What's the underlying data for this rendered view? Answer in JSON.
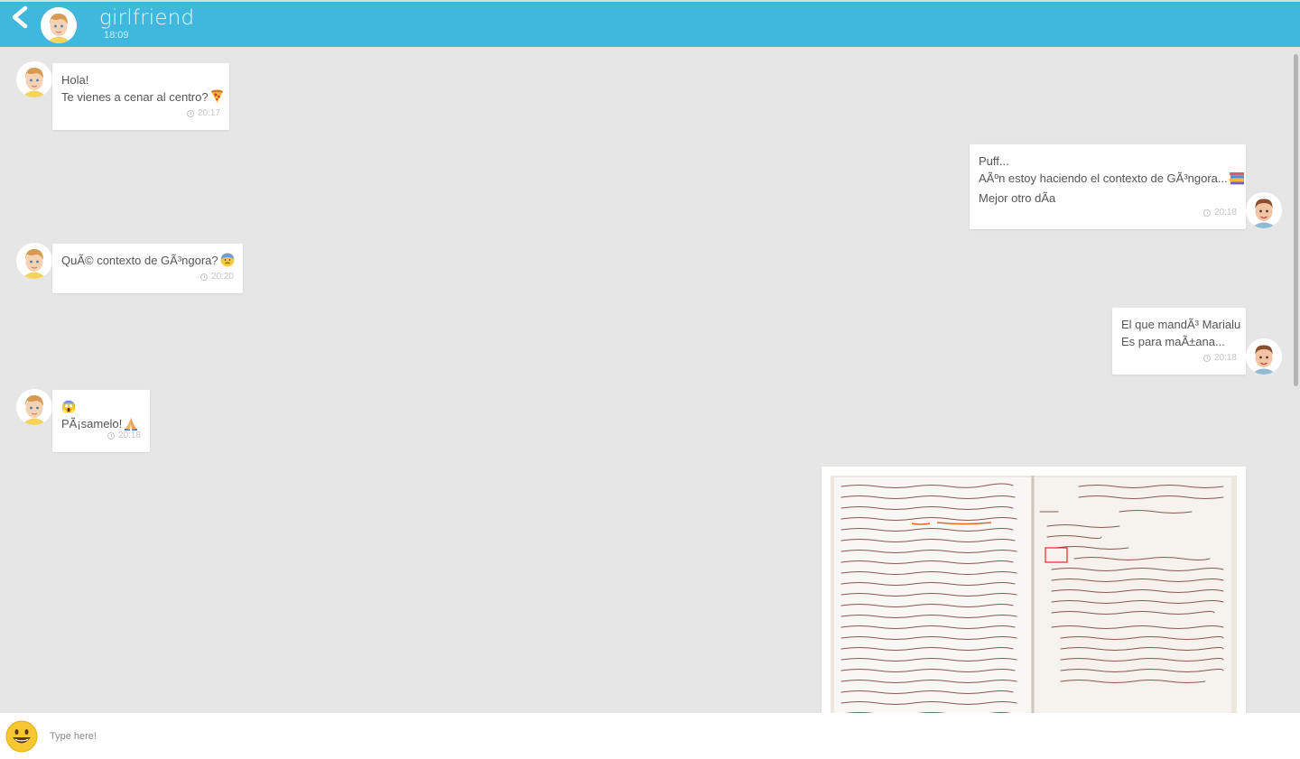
{
  "header": {
    "contact_name": "girlfriend",
    "last_seen": "18:09",
    "color": "#40b8de"
  },
  "messages": [
    {
      "side": "received",
      "lines": [
        "Hola!",
        "Te vienes a cenar al centro?"
      ],
      "emoji": "pizza",
      "time": "20:17"
    },
    {
      "side": "sent",
      "lines": [
        "Puff...",
        "AÃºn estoy haciendo el contexto de GÃ³ngora...",
        "Mejor otro dÃa"
      ],
      "emoji": "books",
      "time": "20:18"
    },
    {
      "side": "received",
      "lines": [
        "QuÃ© contexto de GÃ³ngora?"
      ],
      "emoji": "anxious-face",
      "time": "20:20"
    },
    {
      "side": "sent",
      "lines": [
        "El que mandÃ³ Marialu",
        "Es para maÃ±ana..."
      ],
      "time": "20:18"
    },
    {
      "side": "received",
      "lines": [
        "😱",
        "PÃ¡samelo!"
      ],
      "emoji": "folded-hands",
      "time": "20:18"
    },
    {
      "side": "sent",
      "type": "image",
      "image": "handwritten-notes-photo"
    }
  ],
  "composer": {
    "placeholder": "Type here!",
    "emoji_icon": "smiley-icon"
  }
}
